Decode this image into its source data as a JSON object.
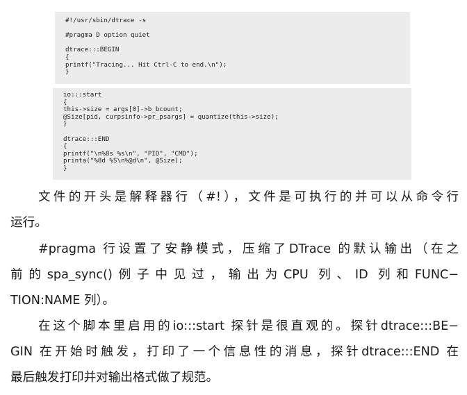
{
  "code_blocks": [
    {
      "lines": [
        "#!/usr/sbin/dtrace -s",
        "",
        "#pragma D option quiet",
        "",
        "dtrace:::BEGIN",
        "{",
        "        printf(\"Tracing... Hit Ctrl-C to end.\\n\");",
        "}"
      ]
    },
    {
      "lines": [
        "io:::start",
        "{",
        "        this->size = args[0]->b_bcount;",
        "        @Size[pid, curpsinfo->pr_psargs] = quantize(this->size);",
        "}",
        "",
        "dtrace:::END",
        "{",
        "        printf(\"\\n%8s  %s\\n\", \"PID\", \"CMD\");",
        "        printa(\"%8d  %S\\n%@d\\n\", @Size);",
        "}"
      ]
    }
  ],
  "paragraphs": [
    {
      "lines": [
        "文件的开头是解释器行（#!），文件是可执行的并可以从命令行",
        "运行。"
      ]
    },
    {
      "lines": [
        "#pragma 行设置了安静模式，压缩了DTrace 的默认输出（在之",
        "前的spa_sync()例子中见过，输出为CPU 列、ID 列和FUNC−",
        "TION:NAME 列）。"
      ]
    },
    {
      "lines": [
        "在这个脚本里启用的io:::start 探针是很直观的。探针dtrace:::BE−",
        "GIN 在开始时触发，打印了一个信息性的消息，探针dtrace:::END 在",
        "最后触发打印并对输出格式做了规范。"
      ]
    }
  ]
}
